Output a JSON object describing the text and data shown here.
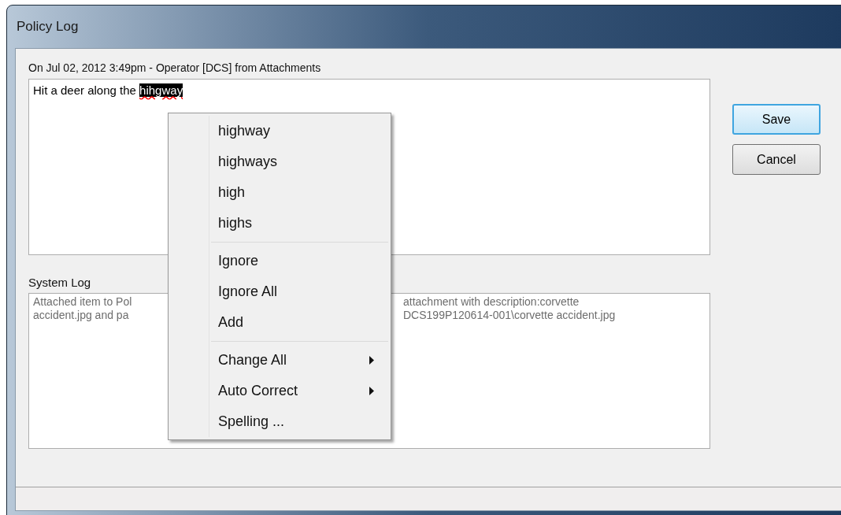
{
  "window": {
    "title": "Policy Log"
  },
  "entry": {
    "header": "On Jul 02, 2012 3:49pm - Operator [DCS] from Attachments",
    "text_before": "Hit a deer along the ",
    "selected_text": "hihgway",
    "misspelled": true
  },
  "system_log": {
    "label": "System Log",
    "lines": [
      {
        "left": "Attached item to Pol",
        "right": "attachment with description:corvette"
      },
      {
        "left": "accident.jpg and pa",
        "right": "DCS199P120614-001\\corvette accident.jpg"
      }
    ]
  },
  "buttons": [
    {
      "label": "Save",
      "focused": true
    },
    {
      "label": "Cancel",
      "focused": false
    }
  ],
  "context_menu": {
    "groups": [
      [
        {
          "label": "highway",
          "submenu": false
        },
        {
          "label": "highways",
          "submenu": false
        },
        {
          "label": "high",
          "submenu": false
        },
        {
          "label": "highs",
          "submenu": false
        }
      ],
      [
        {
          "label": "Ignore",
          "submenu": false
        },
        {
          "label": "Ignore All",
          "submenu": false
        },
        {
          "label": "Add",
          "submenu": false
        }
      ],
      [
        {
          "label": "Change All",
          "submenu": true
        },
        {
          "label": "Auto Correct",
          "submenu": true
        },
        {
          "label": "Spelling ...",
          "submenu": false
        }
      ]
    ]
  }
}
